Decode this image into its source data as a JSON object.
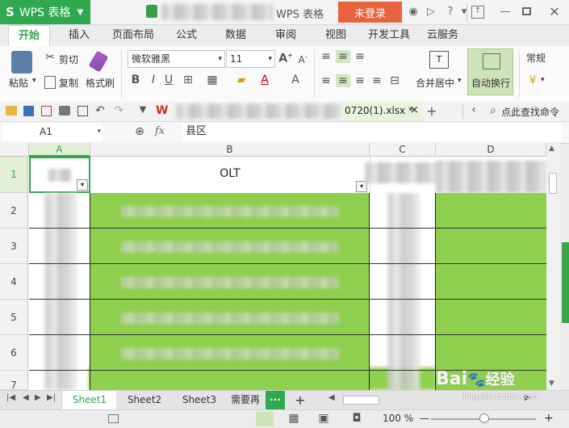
{
  "titlebar": {
    "app_logo": "S",
    "app_name": "WPS 表格",
    "caret": "▼",
    "document_title": "WPS 表格",
    "login_button": "未登录",
    "icons": [
      "skin-icon",
      "feedback-icon",
      "help-icon",
      "minimize-icon",
      "box-icon",
      "maximize-icon",
      "close-icon"
    ]
  },
  "ribbon_tabs": [
    "开始",
    "插入",
    "页面布局",
    "公式",
    "数据",
    "审阅",
    "视图",
    "开发工具",
    "云服务"
  ],
  "ribbon": {
    "paste_label": "粘贴",
    "cut_label": "剪切",
    "copy_label": "复制",
    "format_painter_label": "格式刷",
    "font_name": "微软雅黑",
    "font_size": "11",
    "bold": "B",
    "italic": "I",
    "underline": "U",
    "merge_center_label": "合并居中",
    "wrap_text_label": "自动换行",
    "number_format": "常规"
  },
  "quick_access": {
    "file_tab": "0720(1).xlsx *",
    "close_tab": "×",
    "add_tab": "+",
    "search_label": "点此查找命令"
  },
  "formula_bar": {
    "cell_ref": "A1",
    "fx": "fx",
    "content": "县区"
  },
  "grid": {
    "columns": [
      "A",
      "B",
      "C",
      "D"
    ],
    "rows": [
      "1",
      "2",
      "3",
      "4",
      "5",
      "6",
      "7"
    ],
    "b1_value": "OLT"
  },
  "sheets": {
    "tabs": [
      "Sheet1",
      "Sheet2",
      "Sheet3",
      "需要再"
    ],
    "active": "Sheet1",
    "more": "···",
    "add": "+"
  },
  "status": {
    "zoom": "100 %",
    "zoom_minus": "—",
    "zoom_plus": "+"
  },
  "watermark": {
    "text": "Bai",
    "text2": "经验",
    "url": "jingyan.baidu.com"
  },
  "colors": {
    "accent": "#2fa84f",
    "login": "#e8643c",
    "fill_green": "#8fcf4e"
  }
}
